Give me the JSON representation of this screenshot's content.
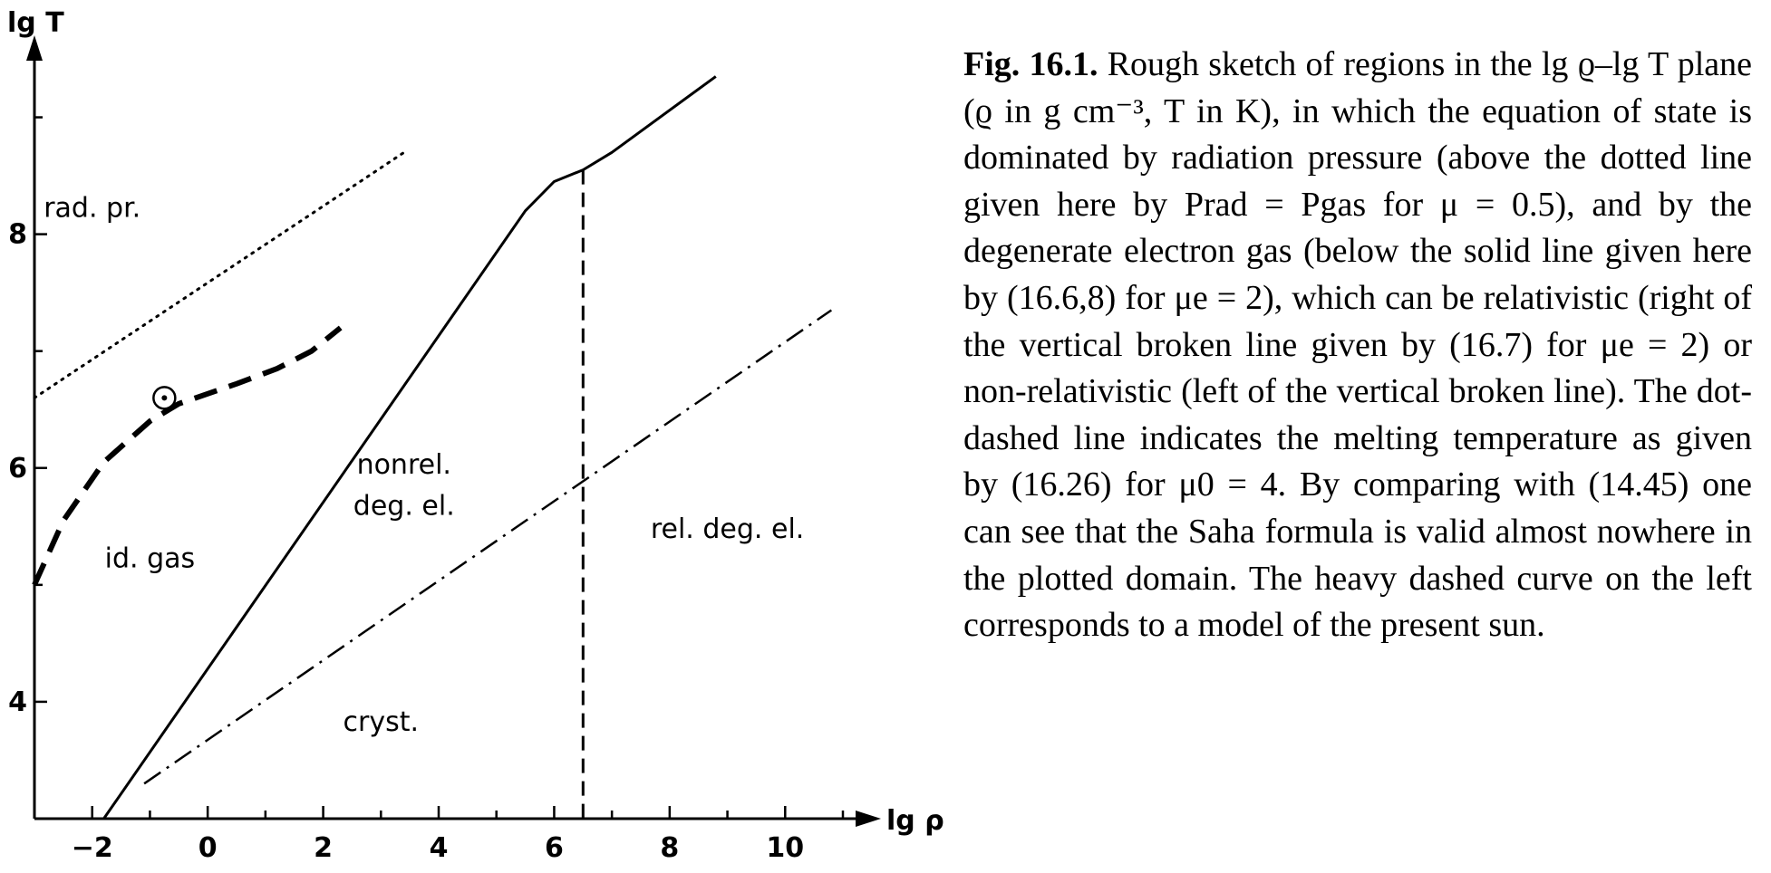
{
  "chart_data": {
    "type": "line",
    "xlabel": "lg ρ",
    "ylabel": "lg T",
    "xlim": [
      -3,
      11
    ],
    "ylim": [
      3,
      9.5
    ],
    "x_ticks": [
      -2,
      0,
      2,
      4,
      6,
      8,
      10
    ],
    "y_ticks": [
      4,
      6,
      8
    ],
    "grid": false,
    "series": [
      {
        "style": "dotted",
        "color": "#000000",
        "points": [
          [
            -3.0,
            6.6
          ],
          [
            3.4,
            8.7
          ]
        ]
      },
      {
        "style": "solid",
        "color": "#000000",
        "points": [
          [
            -1.8,
            3.0
          ],
          [
            5.5,
            8.2
          ],
          [
            6.0,
            8.45
          ],
          [
            6.5,
            8.55
          ],
          [
            7.0,
            8.7
          ],
          [
            8.8,
            9.35
          ]
        ]
      },
      {
        "style": "dashed",
        "color": "#000000",
        "points": [
          [
            6.5,
            8.55
          ],
          [
            6.5,
            3.0
          ]
        ]
      },
      {
        "style": "dashdot",
        "color": "#000000",
        "points": [
          [
            -1.1,
            3.3
          ],
          [
            10.8,
            7.35
          ]
        ]
      },
      {
        "style": "heavy-dashed",
        "color": "#000000",
        "points": [
          [
            -3.0,
            5.0
          ],
          [
            -2.5,
            5.55
          ],
          [
            -1.8,
            6.05
          ],
          [
            -1.0,
            6.4
          ],
          [
            -0.5,
            6.55
          ],
          [
            0.5,
            6.72
          ],
          [
            1.2,
            6.85
          ],
          [
            1.8,
            7.0
          ],
          [
            2.3,
            7.2
          ]
        ]
      }
    ],
    "annotations": [
      {
        "text": "rad. pr.",
        "x": -2.0,
        "y": 8.15
      },
      {
        "text": "id. gas",
        "x": -1.0,
        "y": 5.15
      },
      {
        "text": "nonrel.",
        "x": 3.4,
        "y": 5.95
      },
      {
        "text": "deg. el.",
        "x": 3.4,
        "y": 5.6
      },
      {
        "text": "rel. deg. el.",
        "x": 9.0,
        "y": 5.4
      },
      {
        "text": "cryst.",
        "x": 3.0,
        "y": 3.75
      }
    ],
    "sun_marker": {
      "symbol": "⊙",
      "x": -0.75,
      "y": 6.6
    }
  },
  "caption": {
    "label": "Fig. 16.1.",
    "text": "Rough sketch of regions in the lg ϱ–lg T plane (ϱ in g cm⁻³, T in K), in which the equation of state is dominated by radiation pressure (above the dotted line given here by Prad = Pgas for μ = 0.5), and by the degenerate electron gas (below the solid line given here by (16.6,8) for μe = 2), which can be relativistic (right of the vertical broken line given by (16.7) for μe = 2) or non-relativistic (left of the vertical broken line). The dot-dashed line indicates the melting temperature as given by (16.26) for μ0 = 4. By comparing with (14.45) one can see that the Saha formula is valid almost nowhere in the plotted domain. The heavy dashed curve on the left corresponds to a model of the present sun."
  }
}
